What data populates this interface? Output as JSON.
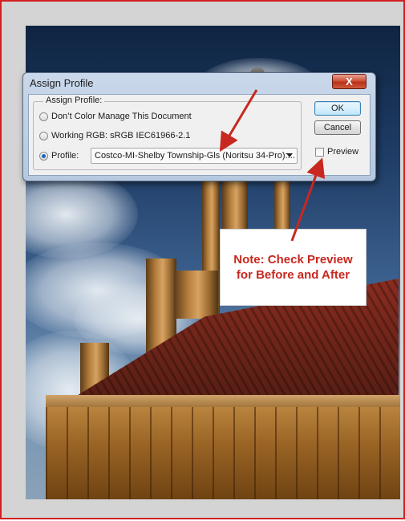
{
  "dialog": {
    "title": "Assign Profile",
    "close_label": "X",
    "group_label": "Assign Profile:",
    "options": [
      {
        "label": "Don’t Color Manage This Document",
        "checked": false
      },
      {
        "label": "Working RGB:  sRGB IEC61966-2.1",
        "checked": false
      },
      {
        "label": "Profile:",
        "checked": true
      }
    ],
    "profile_value": "Costco-MI-Shelby Township-Gls (Noritsu 34-Pro):...",
    "ok_label": "OK",
    "cancel_label": "Cancel",
    "preview_label": "Preview",
    "preview_checked": false
  },
  "annotation": {
    "line1": "Note: Check Preview",
    "line2": "for Before and After",
    "color": "#c8281f"
  },
  "icons": {
    "close": "close-icon",
    "dropdown": "chevron-down-icon"
  }
}
